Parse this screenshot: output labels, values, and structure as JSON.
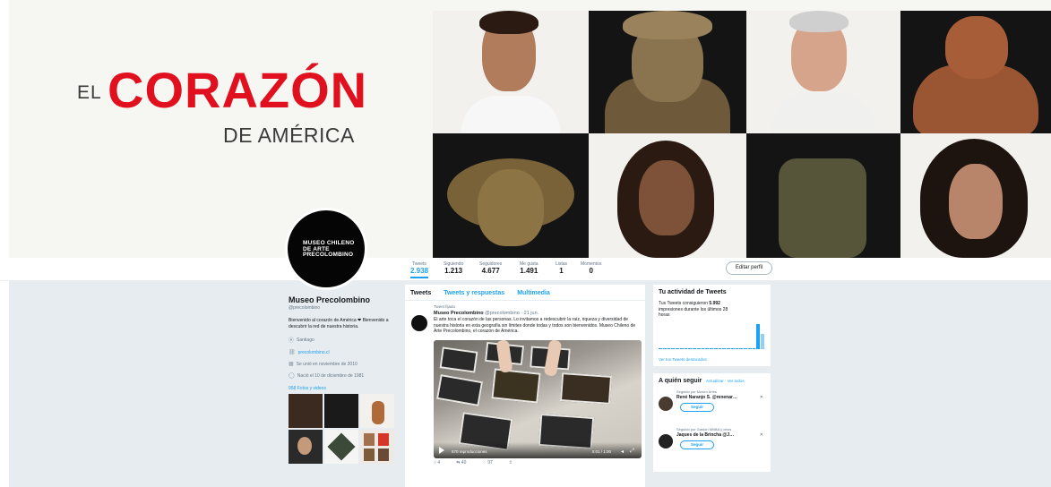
{
  "banner": {
    "headline_prefix": "EL",
    "headline_main": "CORAZÓN",
    "headline_sub": "DE AMÉRICA",
    "accent_color": "#e0101e"
  },
  "profile": {
    "avatar_text": "MUSEO CHILENO DE ARTE PRECOLOMBINO",
    "name": "Museo Precolombino",
    "handle": "@precolombino",
    "bio": "Bienvenido al corazón de América ❤ Bienvenido a descubrir la red de nuestra historia.",
    "location": "Santiago",
    "website": "precolombino.cl",
    "joined": "Se unió en noviembre de 2010",
    "birthday": "Nació el 10 de diciembre de 1981",
    "media_label": "958 Fotos y videos"
  },
  "stats": [
    {
      "label": "Tweets",
      "value": "2.938",
      "active": true
    },
    {
      "label": "Siguiendo",
      "value": "1.213",
      "active": false
    },
    {
      "label": "Seguidores",
      "value": "4.677",
      "active": false
    },
    {
      "label": "Me gusta",
      "value": "1.491",
      "active": false
    },
    {
      "label": "Listas",
      "value": "1",
      "active": false
    },
    {
      "label": "Momentos",
      "value": "0",
      "active": false
    }
  ],
  "edit_profile_label": "Editar perfil",
  "tabs": [
    "Tweets",
    "Tweets y respuestas",
    "Multimedia"
  ],
  "tweet": {
    "pinned_label": "Tweet fijado",
    "author": "Museo Precolombino",
    "meta": "@precolombino · 21 jun.",
    "text": "El arte toca el corazón de las personas. Lo invitamos a redescubrir la raíz, riqueza y diversidad de nuestra historia en esta geografía sin límites donde todas y todos son bienvenidos. Museo Chileno de Arte Precolombino, el corazón de América.",
    "video_views": "570 reproducciones",
    "video_time": "0:01 / 1:00",
    "actions": [
      "4",
      "40",
      "97"
    ]
  },
  "activity": {
    "title": "Tu actividad de Tweets",
    "text_pre": "Tus Tweets consiguieron",
    "impressions": "5.992",
    "text_post": "impresiones durante los últimos 28 horas",
    "link": "Ver tus Tweets destacados",
    "bars": [
      0,
      0,
      0,
      0,
      0,
      0,
      0,
      0,
      0,
      0,
      0,
      0,
      0,
      0,
      0,
      0,
      0,
      0,
      0,
      0,
      0,
      0,
      0,
      0.92,
      0.55
    ]
  },
  "who_to_follow": {
    "title": "A quién seguir",
    "links": "· Actualizar · Ver todos",
    "suggestions": [
      {
        "note": "Seguido por Museo Artes",
        "name": "René Naranjo S. @renenar…",
        "button": "Seguir"
      },
      {
        "note": "Seguido por Gastón MNBA y otros",
        "name": "Jaques de la Brincha @J…",
        "button": "Seguir"
      }
    ]
  }
}
